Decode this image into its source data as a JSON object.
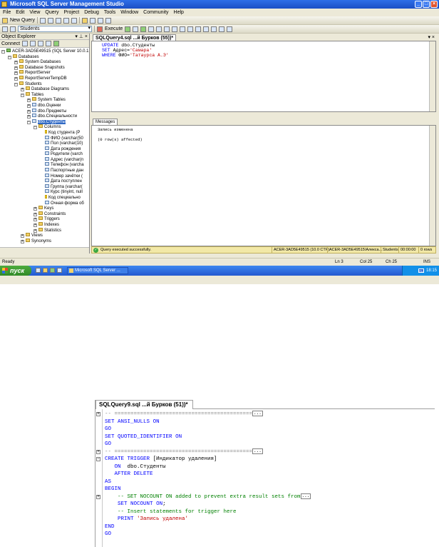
{
  "window": {
    "title": "Microsoft SQL Server Management Studio"
  },
  "menu": [
    "File",
    "Edit",
    "View",
    "Query",
    "Project",
    "Debug",
    "Tools",
    "Window",
    "Community",
    "Help"
  ],
  "toolbar": {
    "new_query": "New Query",
    "database": "Students",
    "execute": "Execute"
  },
  "object_explorer": {
    "title": "Object Explorer",
    "connect": "Connect",
    "tree": [
      {
        "label": "ACER-3AD5E49515 (SQL Server 10.0.1...",
        "level": 0,
        "expander": "−",
        "kind": "srv"
      },
      {
        "label": "Databases",
        "level": 1,
        "expander": "−",
        "kind": "fld"
      },
      {
        "label": "System Databases",
        "level": 2,
        "expander": "+",
        "kind": "fld"
      },
      {
        "label": "Database Snapshots",
        "level": 2,
        "expander": "+",
        "kind": "fld"
      },
      {
        "label": "ReportServer",
        "level": 2,
        "expander": "+",
        "kind": "fld"
      },
      {
        "label": "ReportServerTempDB",
        "level": 2,
        "expander": "+",
        "kind": "fld"
      },
      {
        "label": "Students",
        "level": 2,
        "expander": "−",
        "kind": "fld"
      },
      {
        "label": "Database Diagrams",
        "level": 3,
        "expander": "+",
        "kind": "fld"
      },
      {
        "label": "Tables",
        "level": 3,
        "expander": "−",
        "kind": "fld"
      },
      {
        "label": "System Tables",
        "level": 4,
        "expander": "+",
        "kind": "fld"
      },
      {
        "label": "dbo.Оценки",
        "level": 4,
        "expander": "+",
        "kind": "tbl"
      },
      {
        "label": "dbo.Предметы",
        "level": 4,
        "expander": "+",
        "kind": "tbl"
      },
      {
        "label": "dbo.Специальности",
        "level": 4,
        "expander": "+",
        "kind": "tbl"
      },
      {
        "label": "dbo.Студенты",
        "level": 4,
        "expander": "−",
        "kind": "tbl",
        "selected": true
      },
      {
        "label": "Columns",
        "level": 5,
        "expander": "−",
        "kind": "fld"
      },
      {
        "label": "Код студента (P",
        "level": 6,
        "expander": "",
        "kind": "key"
      },
      {
        "label": "ФИО (varchar(50",
        "level": 6,
        "expander": "",
        "kind": "tbl"
      },
      {
        "label": "Пол (varchar(10)",
        "level": 6,
        "expander": "",
        "kind": "tbl"
      },
      {
        "label": "Дата рождения",
        "level": 6,
        "expander": "",
        "kind": "tbl"
      },
      {
        "label": "Родители (varch",
        "level": 6,
        "expander": "",
        "kind": "tbl"
      },
      {
        "label": "Адрес (varchar(n",
        "level": 6,
        "expander": "",
        "kind": "tbl"
      },
      {
        "label": "Телефон (varcha",
        "level": 6,
        "expander": "",
        "kind": "tbl"
      },
      {
        "label": "Паспортные дан",
        "level": 6,
        "expander": "",
        "kind": "tbl"
      },
      {
        "label": "Номер зачётки (",
        "level": 6,
        "expander": "",
        "kind": "tbl"
      },
      {
        "label": "Дата поступлен",
        "level": 6,
        "expander": "",
        "kind": "tbl"
      },
      {
        "label": "Группа (varchar(",
        "level": 6,
        "expander": "",
        "kind": "tbl"
      },
      {
        "label": "Курс (tinyint, null",
        "level": 6,
        "expander": "",
        "kind": "tbl"
      },
      {
        "label": "Код специально",
        "level": 6,
        "expander": "",
        "kind": "key"
      },
      {
        "label": "Очная форма об",
        "level": 6,
        "expander": "",
        "kind": "tbl"
      },
      {
        "label": "Keys",
        "level": 5,
        "expander": "+",
        "kind": "fld"
      },
      {
        "label": "Constraints",
        "level": 5,
        "expander": "+",
        "kind": "fld"
      },
      {
        "label": "Triggers",
        "level": 5,
        "expander": "+",
        "kind": "fld"
      },
      {
        "label": "Indexes",
        "level": 5,
        "expander": "+",
        "kind": "fld"
      },
      {
        "label": "Statistics",
        "level": 5,
        "expander": "+",
        "kind": "fld"
      },
      {
        "label": "Views",
        "level": 3,
        "expander": "+",
        "kind": "fld"
      },
      {
        "label": "Synonyms",
        "level": 3,
        "expander": "+",
        "kind": "fld"
      }
    ]
  },
  "editor1": {
    "tab": "SQLQuery4.sql ...й Бурков (55))*",
    "lines": [
      {
        "parts": [
          {
            "t": "UPDATE",
            "c": "kw"
          },
          {
            "t": " dbo.Студенты",
            "c": ""
          }
        ]
      },
      {
        "parts": [
          {
            "t": "SET",
            "c": "kw"
          },
          {
            "t": " Адрес=",
            "c": ""
          },
          {
            "t": "'Самара'",
            "c": "str"
          }
        ]
      },
      {
        "parts": [
          {
            "t": "WHERE",
            "c": "kw"
          },
          {
            "t": " ФИО=",
            "c": ""
          },
          {
            "t": "'Татаурса А.Э'",
            "c": "str"
          }
        ]
      }
    ]
  },
  "messages": {
    "tab": "Messages",
    "lines": [
      "Запись изменена",
      "",
      "(0 row(s) affected)"
    ]
  },
  "query_status": {
    "text": "Query executed successfully.",
    "server": "ACER-3AD5E49515 (10.0 CTP)",
    "user": "ACER-3AD5E49515\\Алекса...",
    "db": "Students",
    "time": "00:00:00",
    "rows": "0 rows"
  },
  "statusbar": {
    "ready": "Ready",
    "ln": "Ln 3",
    "col": "Col 25",
    "ch": "Ch 25",
    "ins": "INS"
  },
  "taskbar": {
    "start": "пуск",
    "task": "Microsoft SQL Server ...",
    "lang": "RU",
    "clock": "18:15"
  },
  "editor2": {
    "tab": "SQLQuery9.sql ...й Бурков (51))*",
    "lines": [
      {
        "fold": "+",
        "parts": [
          {
            "t": "-- ===========================================",
            "c": "gray"
          },
          {
            "t": "...",
            "c": "box"
          }
        ]
      },
      {
        "fold": "",
        "parts": [
          {
            "t": "SET",
            "c": "kw"
          },
          {
            "t": " ",
            "c": ""
          },
          {
            "t": "ANSI_NULLS",
            "c": "kw"
          },
          {
            "t": " ",
            "c": ""
          },
          {
            "t": "ON",
            "c": "kw"
          }
        ]
      },
      {
        "fold": "",
        "parts": [
          {
            "t": "GO",
            "c": "kw"
          }
        ]
      },
      {
        "fold": "",
        "parts": [
          {
            "t": "SET",
            "c": "kw"
          },
          {
            "t": " ",
            "c": ""
          },
          {
            "t": "QUOTED_IDENTIFIER",
            "c": "kw"
          },
          {
            "t": " ",
            "c": ""
          },
          {
            "t": "ON",
            "c": "kw"
          }
        ]
      },
      {
        "fold": "",
        "parts": [
          {
            "t": "GO",
            "c": "kw"
          }
        ]
      },
      {
        "fold": "+",
        "parts": [
          {
            "t": "-- ===========================================",
            "c": "gray"
          },
          {
            "t": "...",
            "c": "box"
          }
        ]
      },
      {
        "fold": "−",
        "parts": [
          {
            "t": "CREATE",
            "c": "kw"
          },
          {
            "t": " ",
            "c": ""
          },
          {
            "t": "TRIGGER",
            "c": "kw"
          },
          {
            "t": " [Индикатор удаления]",
            "c": ""
          }
        ]
      },
      {
        "fold": "",
        "parts": [
          {
            "t": "   ",
            "c": ""
          },
          {
            "t": "ON",
            "c": "kw"
          },
          {
            "t": "  dbo.Студенты",
            "c": ""
          }
        ]
      },
      {
        "fold": "",
        "parts": [
          {
            "t": "   ",
            "c": ""
          },
          {
            "t": "AFTER",
            "c": "kw"
          },
          {
            "t": " ",
            "c": ""
          },
          {
            "t": "DELETE",
            "c": "kw"
          }
        ]
      },
      {
        "fold": "",
        "parts": [
          {
            "t": "AS",
            "c": "kw"
          }
        ]
      },
      {
        "fold": "",
        "parts": [
          {
            "t": "BEGIN",
            "c": "kw"
          }
        ]
      },
      {
        "fold": "+",
        "parts": [
          {
            "t": "    -- SET NOCOUNT ON added to prevent extra result sets from",
            "c": "cm"
          },
          {
            "t": "...",
            "c": "box"
          }
        ]
      },
      {
        "fold": "",
        "parts": [
          {
            "t": "    ",
            "c": ""
          },
          {
            "t": "SET",
            "c": "kw"
          },
          {
            "t": " ",
            "c": ""
          },
          {
            "t": "NOCOUNT",
            "c": "kw"
          },
          {
            "t": " ",
            "c": ""
          },
          {
            "t": "ON",
            "c": "kw"
          },
          {
            "t": ";",
            "c": ""
          }
        ]
      },
      {
        "fold": "",
        "parts": [
          {
            "t": "    -- Insert statements for trigger here",
            "c": "cm"
          }
        ]
      },
      {
        "fold": "",
        "parts": [
          {
            "t": "    ",
            "c": ""
          },
          {
            "t": "PRINT",
            "c": "kw"
          },
          {
            "t": " ",
            "c": ""
          },
          {
            "t": "'Запись удалена'",
            "c": "str"
          }
        ]
      },
      {
        "fold": "",
        "parts": [
          {
            "t": "END",
            "c": "kw"
          }
        ]
      },
      {
        "fold": "",
        "parts": [
          {
            "t": "GO",
            "c": "kw"
          }
        ]
      }
    ]
  }
}
